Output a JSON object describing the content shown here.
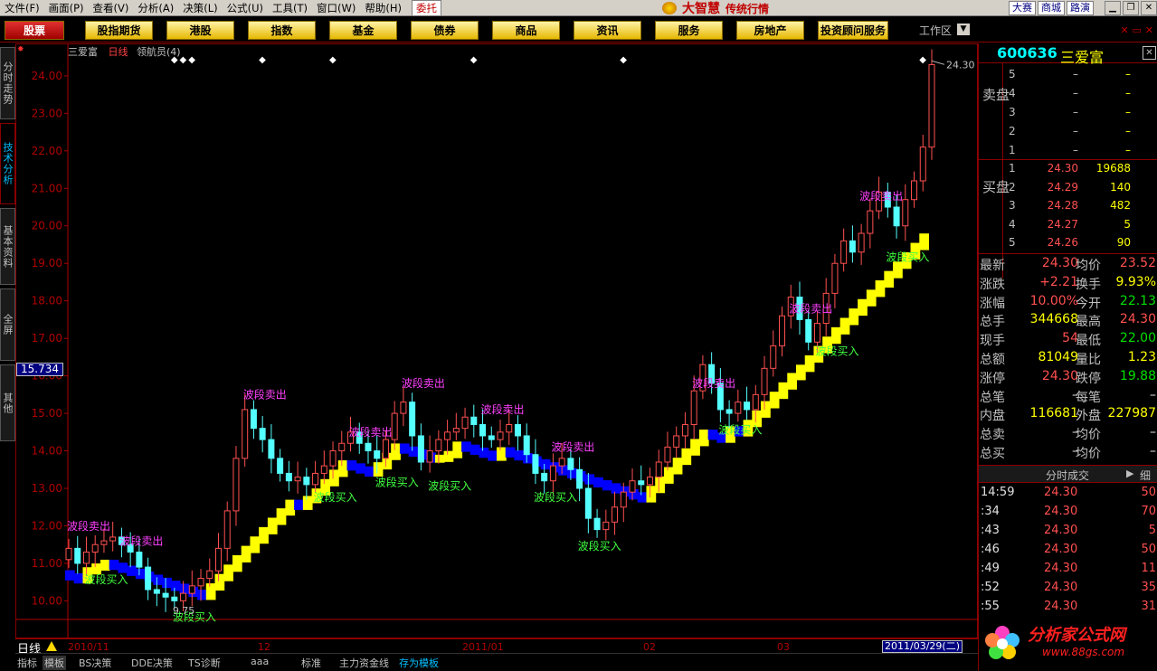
{
  "menu": [
    "文件(F)",
    "画面(P)",
    "查看(V)",
    "分析(A)",
    "决策(L)",
    "公式(U)",
    "工具(T)",
    "窗口(W)",
    "帮助(H)"
  ],
  "entrust": "委托",
  "brand": {
    "name": "大智慧",
    "slogan": "传统行情"
  },
  "right_links": [
    "大赛",
    "商城",
    "路演"
  ],
  "tabs": [
    "股票",
    "股指期货",
    "港股",
    "指数",
    "基金",
    "债券",
    "商品",
    "资讯",
    "服务",
    "房地产",
    "投资顾问服务"
  ],
  "workarea": "工作区",
  "side_tabs": [
    "分时走势",
    "技术分析",
    "基本资料",
    "全屏",
    "其他"
  ],
  "chart": {
    "stock_name": "三爱富",
    "period": "日线",
    "indicator": "领航员(4)",
    "cursor_value": "15.734",
    "period_label": "日线",
    "max_label": "24.30",
    "min_label": "9.75",
    "date_labels": [
      "2010/11",
      "12",
      "2011/01",
      "02",
      "03"
    ],
    "cursor_date": "2011/03/29(二)",
    "buy_text": "波段买入",
    "sell_text": "波段卖出"
  },
  "chart_data": {
    "type": "candlestick",
    "title": "三爱富 日线 领航员(4)",
    "ylim": [
      9.6,
      24.6
    ],
    "yticks": [
      10.0,
      11.0,
      12.0,
      13.0,
      14.0,
      15.0,
      16.0,
      17.0,
      18.0,
      19.0,
      20.0,
      21.0,
      22.0,
      23.0,
      24.0
    ],
    "ytick_labels": [
      "10.00",
      "11.00",
      "12.00",
      "13.00",
      "14.00",
      "15.00",
      "16.00",
      "17.00",
      "18.00",
      "19.00",
      "20.00",
      "21.00",
      "22.00",
      "23.00",
      "24.00"
    ],
    "closes": [
      11.4,
      11.0,
      11.3,
      11.5,
      11.6,
      11.7,
      11.5,
      11.3,
      10.9,
      10.3,
      10.2,
      10.1,
      10.0,
      10.2,
      10.4,
      10.6,
      10.8,
      11.4,
      12.4,
      13.8,
      15.1,
      14.6,
      14.3,
      13.8,
      13.4,
      13.2,
      13.3,
      13.1,
      13.4,
      13.6,
      14.0,
      14.2,
      14.5,
      14.2,
      14.0,
      13.8,
      14.3,
      15.0,
      15.3,
      14.4,
      13.7,
      14.0,
      14.3,
      14.5,
      14.6,
      14.9,
      14.7,
      14.4,
      14.3,
      14.5,
      14.7,
      14.4,
      13.9,
      13.4,
      13.2,
      13.6,
      13.8,
      13.5,
      13.0,
      12.2,
      11.9,
      12.1,
      12.5,
      12.9,
      13.2,
      13.1,
      13.3,
      13.7,
      14.1,
      14.4,
      14.7,
      15.6,
      16.3,
      15.8,
      15.1,
      15.0,
      15.3,
      15.1,
      15.5,
      16.2,
      16.8,
      17.6,
      18.1,
      17.5,
      16.9,
      17.4,
      18.2,
      19.0,
      19.6,
      19.3,
      19.8,
      20.4,
      20.9,
      20.5,
      20.0,
      20.7,
      21.2,
      22.1,
      24.3
    ],
    "signals": [
      {
        "i": 0,
        "type": "sell",
        "price": 11.8
      },
      {
        "i": 2,
        "type": "buy",
        "price": 10.8
      },
      {
        "i": 6,
        "type": "sell",
        "price": 11.4
      },
      {
        "i": 12,
        "type": "buy",
        "price": 9.8
      },
      {
        "i": 20,
        "type": "sell",
        "price": 15.3
      },
      {
        "i": 28,
        "type": "buy",
        "price": 13.0
      },
      {
        "i": 32,
        "type": "sell",
        "price": 14.3
      },
      {
        "i": 35,
        "type": "buy",
        "price": 13.4
      },
      {
        "i": 38,
        "type": "sell",
        "price": 15.6
      },
      {
        "i": 41,
        "type": "buy",
        "price": 13.3
      },
      {
        "i": 47,
        "type": "sell",
        "price": 14.9
      },
      {
        "i": 53,
        "type": "buy",
        "price": 13.0
      },
      {
        "i": 55,
        "type": "sell",
        "price": 13.9
      },
      {
        "i": 58,
        "type": "buy",
        "price": 11.7
      },
      {
        "i": 71,
        "type": "sell",
        "price": 15.6
      },
      {
        "i": 74,
        "type": "buy",
        "price": 14.8
      },
      {
        "i": 82,
        "type": "sell",
        "price": 17.6
      },
      {
        "i": 85,
        "type": "buy",
        "price": 16.9
      },
      {
        "i": 90,
        "type": "sell",
        "price": 20.6
      },
      {
        "i": 93,
        "type": "buy",
        "price": 19.4
      }
    ],
    "markers_top": [
      12,
      13,
      14,
      22,
      30,
      46,
      63,
      97
    ]
  },
  "quote": {
    "code": "600636",
    "name": "三爱富",
    "sell_side": "卖盘",
    "buy_side": "买盘",
    "asks": [
      {
        "lv": "5",
        "px": "–",
        "vol": "–"
      },
      {
        "lv": "4",
        "px": "–",
        "vol": "–"
      },
      {
        "lv": "3",
        "px": "–",
        "vol": "–"
      },
      {
        "lv": "2",
        "px": "–",
        "vol": "–"
      },
      {
        "lv": "1",
        "px": "–",
        "vol": "–"
      }
    ],
    "bids": [
      {
        "lv": "1",
        "px": "24.30",
        "vol": "19688"
      },
      {
        "lv": "2",
        "px": "24.29",
        "vol": "140"
      },
      {
        "lv": "3",
        "px": "24.28",
        "vol": "482"
      },
      {
        "lv": "4",
        "px": "24.27",
        "vol": "5"
      },
      {
        "lv": "5",
        "px": "24.26",
        "vol": "90"
      }
    ],
    "stats": [
      {
        "l1": "最新",
        "v1": "24.30",
        "c1": "red",
        "l2": "均价",
        "v2": "23.52",
        "c2": "red"
      },
      {
        "l1": "涨跌",
        "v1": "+2.21",
        "c1": "red",
        "l2": "换手",
        "v2": "9.93%",
        "c2": "yellow"
      },
      {
        "l1": "涨幅",
        "v1": "10.00%",
        "c1": "red",
        "l2": "今开",
        "v2": "22.13",
        "c2": "green"
      },
      {
        "l1": "总手",
        "v1": "344668",
        "c1": "yellow",
        "l2": "最高",
        "v2": "24.30",
        "c2": "red"
      },
      {
        "l1": "现手",
        "v1": "54",
        "c1": "red",
        "l2": "最低",
        "v2": "22.00",
        "c2": "green"
      },
      {
        "l1": "总额",
        "v1": "81049",
        "c1": "yellow",
        "l2": "量比",
        "v2": "1.23",
        "c2": "yellow"
      },
      {
        "l1": "涨停",
        "v1": "24.30",
        "c1": "red",
        "l2": "跌停",
        "v2": "19.88",
        "c2": "green"
      },
      {
        "l1": "总笔",
        "v1": "–",
        "c1": "white",
        "l2": "每笔",
        "v2": "–",
        "c2": "white"
      },
      {
        "l1": "内盘",
        "v1": "116681",
        "c1": "yellow",
        "l2": "外盘",
        "v2": "227987",
        "c2": "yellow"
      },
      {
        "l1": "总卖",
        "v1": "–",
        "c1": "white",
        "l2": "均价",
        "v2": "–",
        "c2": "white"
      },
      {
        "l1": "总买",
        "v1": "–",
        "c1": "white",
        "l2": "均价",
        "v2": "–",
        "c2": "white"
      }
    ],
    "ticks_title": "分时成交",
    "ticks_detail": "细",
    "ticks": [
      {
        "t": "14:59",
        "p": "24.30",
        "v": "50"
      },
      {
        "t": ":34",
        "p": "24.30",
        "v": "70"
      },
      {
        "t": ":43",
        "p": "24.30",
        "v": "5"
      },
      {
        "t": ":46",
        "p": "24.30",
        "v": "50"
      },
      {
        "t": ":49",
        "p": "24.30",
        "v": "11"
      },
      {
        "t": ":52",
        "p": "24.30",
        "v": "35"
      },
      {
        "t": ":55",
        "p": "24.30",
        "v": "31"
      }
    ],
    "watermark": "分析家公式网",
    "watermark_url": "www.88gs.com"
  },
  "bottom_tabs": [
    "指标",
    "模板",
    "BS决策",
    "DDE决策",
    "TS诊断",
    "aaa",
    "标准",
    "主力资金线",
    "存为模板"
  ],
  "colors": {
    "up": "#ff5050",
    "down": "#54ffff",
    "support_up": "#ffff00",
    "support_down": "#0000ff",
    "sell_text": "#ff40ff",
    "buy_text": "#40ff40",
    "axis": "#b00000"
  }
}
